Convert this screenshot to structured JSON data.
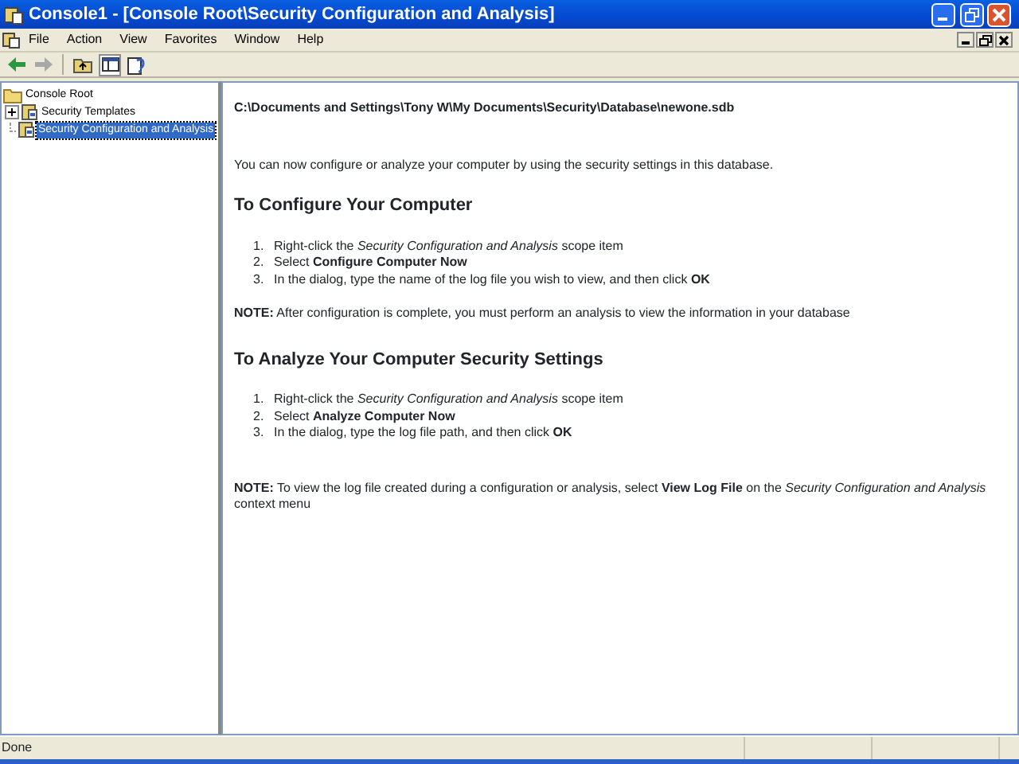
{
  "window": {
    "title": "Console1 - [Console Root\\Security Configuration and Analysis]"
  },
  "menu": [
    "File",
    "Action",
    "View",
    "Favorites",
    "Window",
    "Help"
  ],
  "tree": [
    {
      "label": "Console Root",
      "kind": "root",
      "selected": false,
      "children": [
        {
          "label": "Security Templates",
          "kind": "collapsed",
          "selected": false
        },
        {
          "label": "Security Configuration and Analysis",
          "kind": "leaf",
          "selected": true
        }
      ]
    }
  ],
  "content": {
    "path": "C:\\Documents and Settings\\Tony W\\My Documents\\Security\\Database\\newone.sdb",
    "intro": "You can now configure or analyze your computer by using the security settings in this database.",
    "sections": [
      {
        "heading": "To Configure Your Computer",
        "steps": [
          {
            "number": "1.",
            "text": "Right-click the *Security Configuration and Analysis* scope item"
          },
          {
            "number": "2.",
            "text": "Select **Configure Computer Now**"
          },
          {
            "number": "3.",
            "text": "In the dialog, type the name of the log file you wish to view, and then click **OK**"
          }
        ],
        "note": "**NOTE:** After configuration is complete, you must perform an analysis to view the information in your database"
      },
      {
        "heading": "To Analyze Your Computer Security Settings",
        "steps": [
          {
            "number": "1.",
            "text": "Right-click the *Security Configuration and Analysis* scope item"
          },
          {
            "number": "2.",
            "text": "Select **Analyze Computer Now**"
          },
          {
            "number": "3.",
            "text": "In the dialog, type the log file path, and then click **OK**"
          }
        ],
        "note": "**NOTE:** To view the log file created during a configuration or analysis, select **View Log File** on the *Security Configuration and Analysis* context menu"
      }
    ]
  },
  "status_bar": {
    "text": "Done"
  }
}
